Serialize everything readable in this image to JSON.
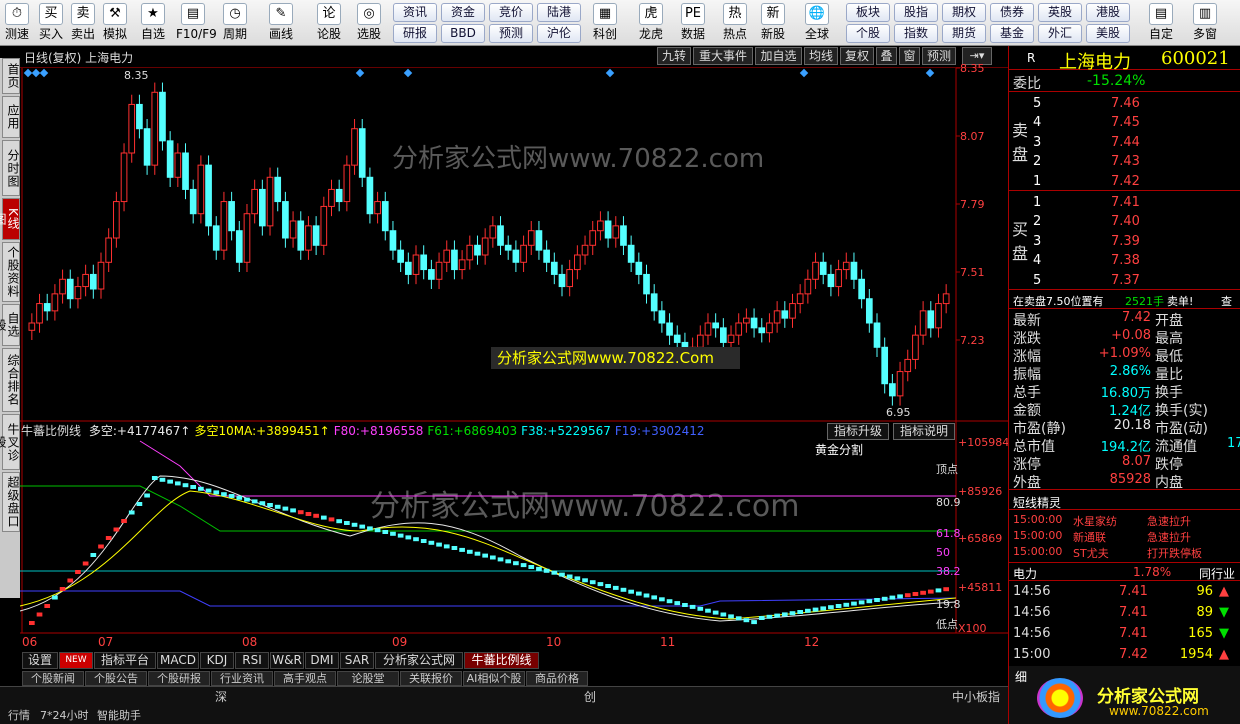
{
  "toolbar": {
    "left": [
      {
        "l": "测速",
        "i": "⏱"
      },
      {
        "l": "买入",
        "i": "买"
      },
      {
        "l": "卖出",
        "i": "卖"
      },
      {
        "l": "模拟",
        "i": "⚒"
      },
      {
        "l": "自选",
        "i": "★"
      },
      {
        "l": "F10/F9",
        "i": "▤"
      },
      {
        "l": "周期",
        "i": "◷"
      },
      {
        "l": "画线",
        "i": "✎"
      },
      {
        "l": "论股",
        "i": "论"
      },
      {
        "l": "选股",
        "i": "◎"
      }
    ],
    "pills": [
      "资讯",
      "资金",
      "竞价",
      "陆港",
      "研报",
      "BBD",
      "预测",
      "沪伦"
    ],
    "mid": [
      {
        "l": "科创",
        "i": "▦"
      },
      {
        "l": "龙虎",
        "i": "虎"
      },
      {
        "l": "数据",
        "i": "PE"
      },
      {
        "l": "热点",
        "i": "热"
      },
      {
        "l": "新股",
        "i": "新"
      },
      {
        "l": "全球",
        "i": "🌐"
      }
    ],
    "pills2": [
      "板块",
      "股指",
      "期权",
      "债券",
      "英股",
      "港股",
      "个股",
      "指数",
      "期货",
      "基金",
      "外汇",
      "美股"
    ],
    "right": [
      {
        "l": "自定",
        "i": "▤"
      },
      {
        "l": "多窗",
        "i": "▥"
      }
    ]
  },
  "leftnav": [
    "首页",
    "应用",
    "分时图",
    "K线图",
    "个股资料",
    "自选股",
    "综合排名",
    "牛叉诊股",
    "超级盘口"
  ],
  "chart": {
    "title": "日线(复权) 上海电力",
    "tools": [
      "九转",
      "重大事件",
      "加自选",
      "均线",
      "复权",
      "叠",
      "窗",
      "预测"
    ],
    "price_ticks": [
      "8.35",
      "8.07",
      "7.79",
      "7.51",
      "7.23",
      "6.95"
    ],
    "high_label": "8.35",
    "low_label": "6.95",
    "watermark1": "分析家公式网www.70822.com",
    "watermark2": "分析家公式网www.70822.Com",
    "watermark3": "分析家公式网www.70822.com"
  },
  "indicator": {
    "name": "牛蕃比例线",
    "items": [
      {
        "t": "多空:",
        "v": "+4177467↑",
        "c": "#e8e8e8"
      },
      {
        "t": "多空10MA:",
        "v": "+3899451↑",
        "c": "#ffff00"
      },
      {
        "t": "F80:",
        "v": "+8196558",
        "c": "#ff40ff"
      },
      {
        "t": "F61:",
        "v": "+6869403",
        "c": "#00e000"
      },
      {
        "t": "F38:",
        "v": "+5229567",
        "c": "#00ffff"
      },
      {
        "t": "F19:",
        "v": "+3902412",
        "c": "#4060ff"
      }
    ],
    "buttons": [
      "指标升级",
      "指标说明"
    ],
    "golden": "黄金分割",
    "level_labels": [
      "顶点",
      "80.9",
      "61.8",
      "50",
      "38.2",
      "19.8",
      "低点"
    ],
    "axis": [
      "+105984",
      "+85926",
      "+65869",
      "+45811",
      "X100"
    ]
  },
  "xaxis": [
    "06",
    "07",
    "08",
    "09",
    "10",
    "11",
    "12"
  ],
  "bottom_tabs": [
    "设置",
    "NEW",
    "指标平台",
    "MACD",
    "KDJ",
    "RSI",
    "W&R",
    "DMI",
    "SAR",
    "分析家公式网",
    "牛蕃比例线"
  ],
  "bottom_nav": [
    "个股新闻",
    "个股公告",
    "个股研报",
    "行业资讯",
    "高手观点",
    "论股堂",
    "关联报价",
    "AI相似个股",
    "商品价格"
  ],
  "status": [
    "行情",
    "7*24小时",
    "智能助手",
    "深",
    "创",
    "中小板指"
  ],
  "right": {
    "title": "上海电力",
    "code": "600021",
    "label_r": "R",
    "weibi_label": "委比",
    "weibi": "-15.24%",
    "sell_label": "卖盘",
    "buy_label": "买盘",
    "sell": [
      {
        "n": "5",
        "p": "7.46"
      },
      {
        "n": "4",
        "p": "7.45"
      },
      {
        "n": "3",
        "p": "7.44"
      },
      {
        "n": "2",
        "p": "7.43"
      },
      {
        "n": "1",
        "p": "7.42"
      }
    ],
    "buy": [
      {
        "n": "1",
        "p": "7.41"
      },
      {
        "n": "2",
        "p": "7.40"
      },
      {
        "n": "3",
        "p": "7.39"
      },
      {
        "n": "4",
        "p": "7.38"
      },
      {
        "n": "5",
        "p": "7.37"
      }
    ],
    "notice": "在卖盘7.50位置有",
    "notice_v": "2521手",
    "notice_t": "卖单!",
    "notice_q": "查",
    "stats": [
      {
        "k": "最新",
        "v": "7.42",
        "k2": "开盘",
        "c": "red"
      },
      {
        "k": "涨跌",
        "v": "+0.08",
        "k2": "最高",
        "c": "red"
      },
      {
        "k": "涨幅",
        "v": "+1.09%",
        "k2": "最低",
        "c": "red"
      },
      {
        "k": "振幅",
        "v": "2.86%",
        "k2": "量比",
        "c": "cyn"
      },
      {
        "k": "总手",
        "v": "16.80万",
        "k2": "换手",
        "c": "cyn"
      },
      {
        "k": "金额",
        "v": "1.24亿",
        "k2": "换手(实)",
        "c": "cyn"
      },
      {
        "k": "市盈(静)",
        "v": "20.18",
        "k2": "市盈(动)",
        "c": "wht"
      },
      {
        "k": "总市值",
        "v": "194.2亿",
        "k2": "流通值",
        "c": "cyn"
      },
      {
        "k": "涨停",
        "v": "8.07",
        "k2": "跌停",
        "c": "red"
      },
      {
        "k": "外盘",
        "v": "85928",
        "k2": "内盘",
        "c": "red"
      }
    ],
    "stats_right": [
      "",
      "",
      "",
      "",
      "",
      "",
      "",
      "17",
      "",
      ""
    ],
    "short_title": "短线精灵",
    "short": [
      {
        "t": "15:00:00",
        "s": "水星家纺",
        "e": "急速拉升"
      },
      {
        "t": "15:00:00",
        "s": "新通联",
        "e": "急速拉升"
      },
      {
        "t": "15:00:00",
        "s": "ST尤夫",
        "e": "打开跌停板"
      }
    ],
    "sector": "电力",
    "sector_v": "1.78%",
    "sector_r": "同行业",
    "ticks": [
      {
        "t": "14:56",
        "p": "7.41",
        "v": "96",
        "d": "up"
      },
      {
        "t": "14:56",
        "p": "7.41",
        "v": "89",
        "d": "dn"
      },
      {
        "t": "14:56",
        "p": "7.41",
        "v": "165",
        "d": "dn"
      },
      {
        "t": "15:00",
        "p": "7.42",
        "v": "1954",
        "d": "up"
      }
    ],
    "detail": "细",
    "logo": "分析家公式网",
    "logo_url": "www.70822.com"
  }
}
